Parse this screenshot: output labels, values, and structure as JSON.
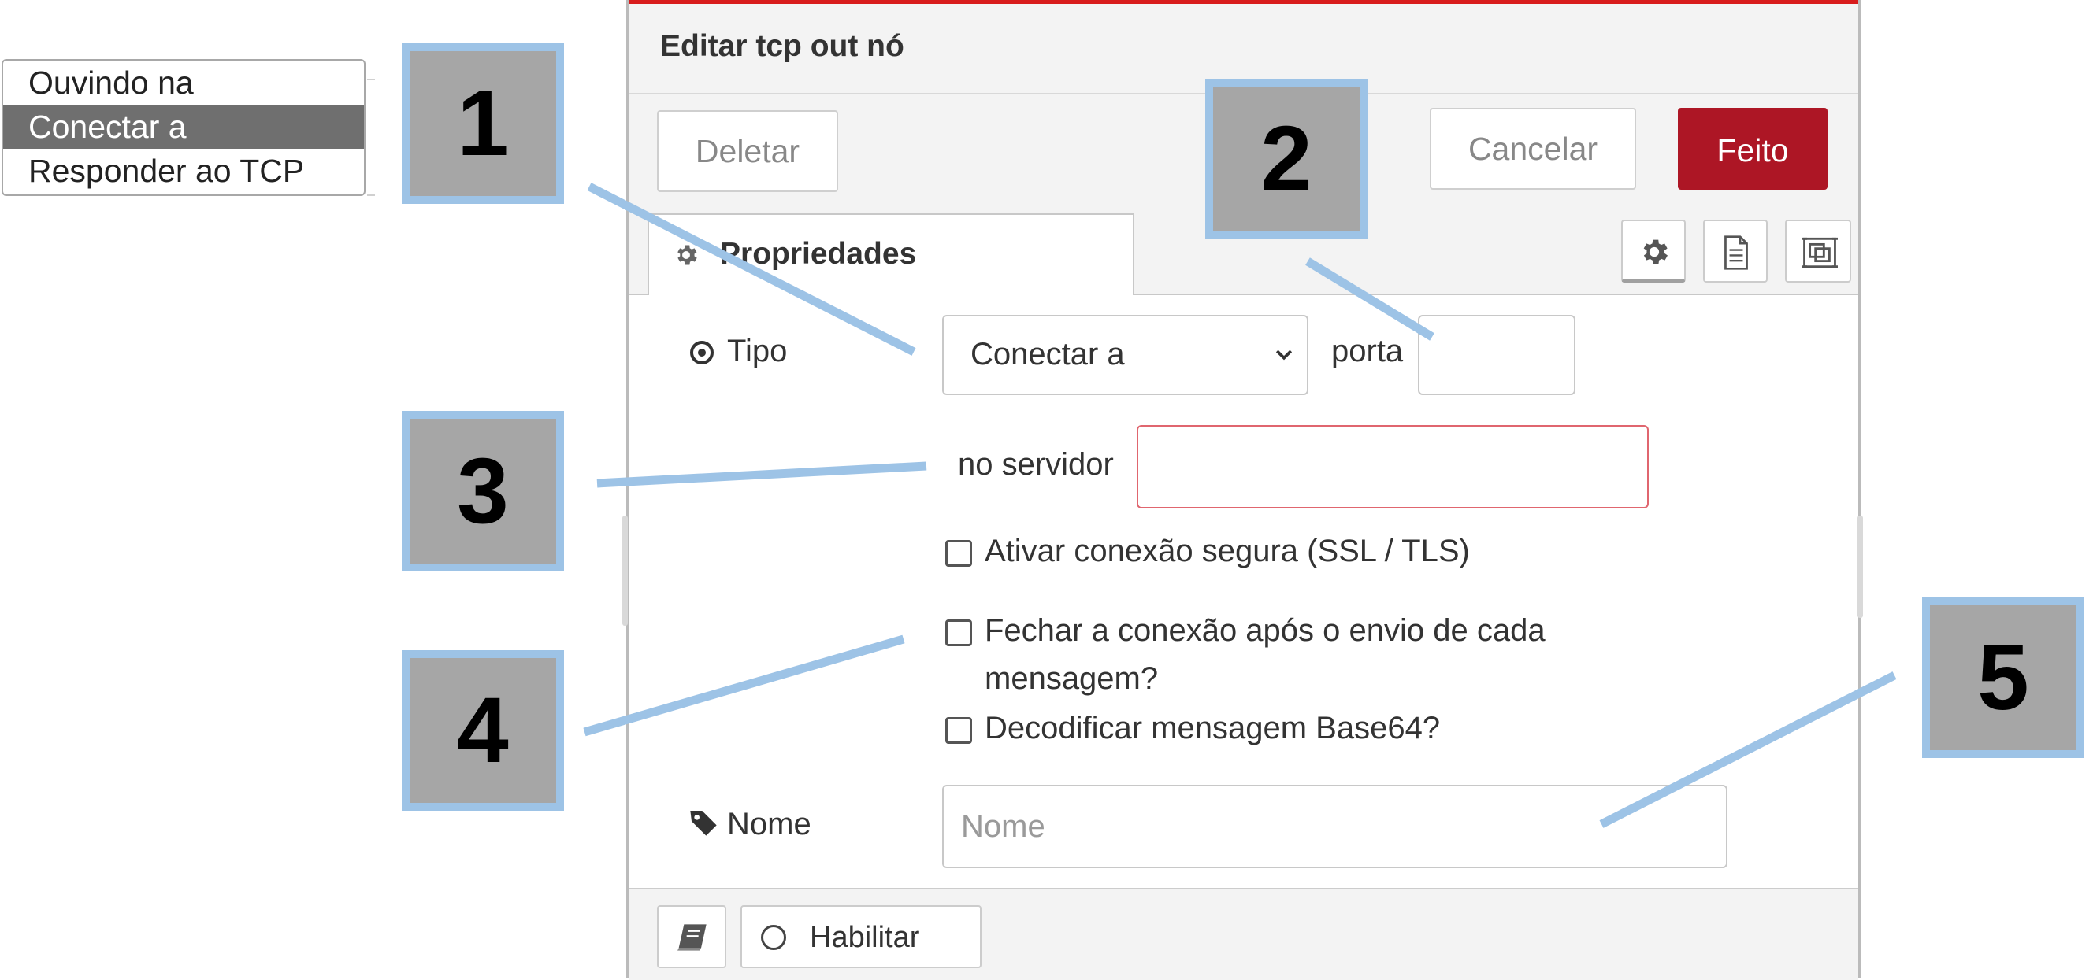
{
  "dropdown_options": {
    "items": [
      "Ouvindo na",
      "Conectar a",
      "Responder ao TCP"
    ],
    "selected_index": 1
  },
  "editor": {
    "title": "Editar tcp out nó",
    "toolbar": {
      "delete_label": "Deletar",
      "cancel_label": "Cancelar",
      "done_label": "Feito",
      "done_color": "#ad1625"
    },
    "tabs": {
      "properties_label": "Propriedades",
      "icons": [
        "gear-icon",
        "document-icon",
        "frame-icon"
      ]
    },
    "form": {
      "type_label": "Tipo",
      "type_value": "Conectar a",
      "port_label": "porta",
      "port_value": "",
      "server_label": "no servidor",
      "server_value": "",
      "ssl_label": "Ativar conexão segura (SSL / TLS)",
      "ssl_checked": false,
      "close_label_line1": "Fechar a conexão após o envio de cada",
      "close_label_line2": "mensagem?",
      "close_checked": false,
      "base64_label": "Decodificar mensagem Base64?",
      "base64_checked": false,
      "name_label": "Nome",
      "name_value": "",
      "name_placeholder": "Nome"
    },
    "footer": {
      "enable_label": "Habilitar"
    },
    "accent_color": "#d81c1c"
  },
  "callouts": [
    "1",
    "2",
    "3",
    "4",
    "5"
  ],
  "callout_colors": {
    "fill": "#a6a6a6",
    "border": "#9dc3e6"
  }
}
